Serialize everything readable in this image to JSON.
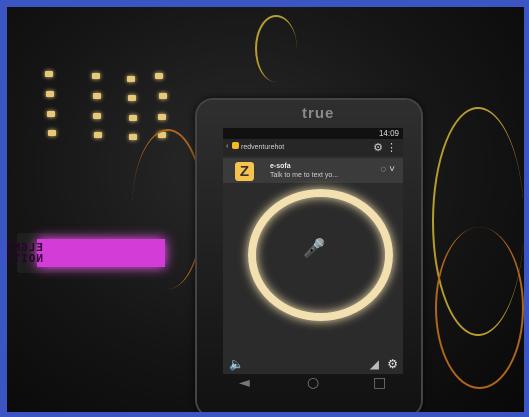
{
  "lcd": {
    "line1": "ELGMIS",
    "line2": "NOITCES"
  },
  "phone": {
    "brand": "true",
    "status": {
      "time": "14:09"
    },
    "app_bar": {
      "title": "redventurehot"
    },
    "header": {
      "logo": "Z",
      "name": "e-sofa",
      "message": "Talk to me to text yo..."
    },
    "bottom": {
      "left_icon": "speaker-icon",
      "right_icon_1": "signal-icon",
      "right_icon_2": "gear-icon"
    },
    "nav": {
      "back": "◄",
      "home": "○",
      "recent": "□"
    }
  },
  "colors": {
    "frame": "#3b55c4",
    "lcd": "#d33cd6",
    "ring": "#f2e0b0"
  }
}
